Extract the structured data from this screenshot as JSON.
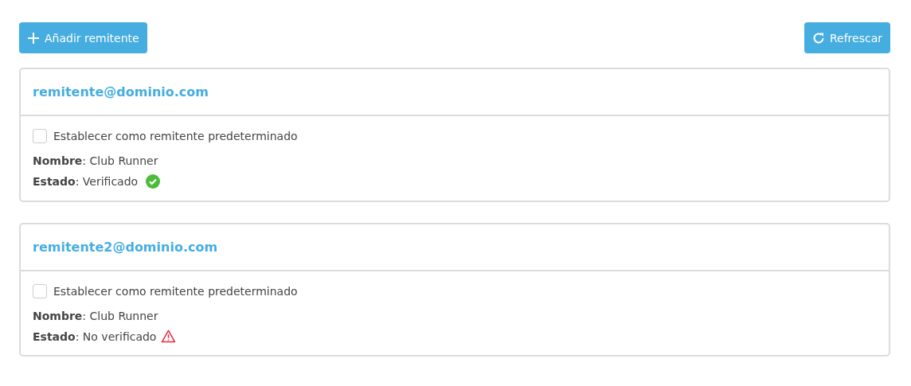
{
  "toolbar": {
    "add_button": "Añadir remitente",
    "refresh_button": "Refrescar"
  },
  "senders": [
    {
      "email": "remitente@dominio.com",
      "default_label": "Establecer como remitente predeterminado",
      "checked": false,
      "name_line": "**Nombre**: Club Runner",
      "status": {
        "text": "**Estado**: Verificado",
        "kind": "verified"
      }
    },
    {
      "email": "remitente2@dominio.com",
      "default_label": "Establecer como remitente predeterminado",
      "checked": false,
      "name_line": "**Nombre**: Club Runner",
      "status": {
        "text": "**Estado**: No verificado",
        "kind": "unverified"
      }
    }
  ]
}
